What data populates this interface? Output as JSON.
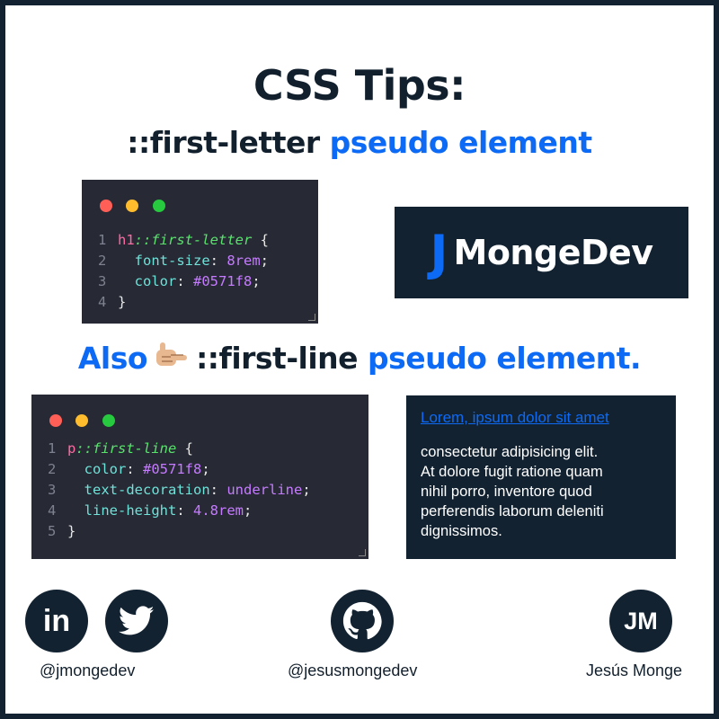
{
  "colors": {
    "navy": "#122231",
    "accent": "#0571f8",
    "editor_bg": "#272934"
  },
  "header": {
    "title": "CSS Tips:",
    "subtitle_dark": "::first-letter",
    "subtitle_blue": "pseudo element"
  },
  "snippet1": {
    "lines": [
      {
        "num": "1",
        "sel": "h1",
        "pseudo": "::first-letter",
        "rest": " {"
      },
      {
        "num": "2",
        "prop": "font-size",
        "val": "8rem"
      },
      {
        "num": "3",
        "prop": "color",
        "val": "#0571f8"
      },
      {
        "num": "4",
        "close": "}"
      }
    ]
  },
  "logo": {
    "initial": "J",
    "name": "MongeDev"
  },
  "also": {
    "word": "Also",
    "icon": "pointing-hand-icon",
    "dark": "::first-line",
    "blue": "pseudo element."
  },
  "snippet2": {
    "lines": [
      {
        "num": "1",
        "sel": "p",
        "pseudo": "::first-line",
        "rest": " {"
      },
      {
        "num": "2",
        "prop": "color",
        "val": "#0571f8"
      },
      {
        "num": "3",
        "prop": "text-decoration",
        "val": "underline"
      },
      {
        "num": "4",
        "prop": "line-height",
        "val": "4.8rem"
      },
      {
        "num": "5",
        "close": "}"
      }
    ]
  },
  "demo": {
    "first_line": "Lorem, ipsum dolor sit amet",
    "rest_lines": [
      "consectetur adipisicing elit.",
      "At dolore fugit ratione quam",
      "nihil porro, inventore quod",
      "perferendis laborum deleniti",
      "dignissimos."
    ]
  },
  "footer": {
    "social_handle": "@jmongedev",
    "github_handle": "@jesusmongedev",
    "avatar_initials": "JM",
    "author": "Jesús Monge",
    "icons": [
      "linkedin-icon",
      "twitter-icon",
      "github-icon"
    ],
    "linkedin_text": "in"
  }
}
